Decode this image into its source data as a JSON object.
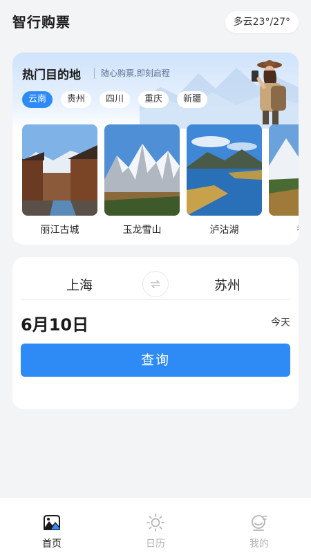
{
  "header": {
    "title": "智行购票",
    "weather": "多云23°/27°"
  },
  "destinations": {
    "title": "热门目的地",
    "subtitle": "随心购票,即刻启程",
    "chips": [
      {
        "label": "云南",
        "active": true
      },
      {
        "label": "贵州",
        "active": false
      },
      {
        "label": "四川",
        "active": false
      },
      {
        "label": "重庆",
        "active": false
      },
      {
        "label": "新疆",
        "active": false
      }
    ],
    "spots": [
      {
        "name": "丽江古城"
      },
      {
        "name": "玉龙雪山"
      },
      {
        "name": "泸沽湖"
      },
      {
        "name": "香格"
      }
    ]
  },
  "route": {
    "from": "上海",
    "to": "苏州",
    "date": "6月10日",
    "date_tag": "今天",
    "search_label": "查询"
  },
  "tabbar": {
    "items": [
      {
        "label": "首页",
        "icon": "home-mountain-icon",
        "active": true
      },
      {
        "label": "日历",
        "icon": "sun-icon",
        "active": false
      },
      {
        "label": "我的",
        "icon": "profile-icon",
        "active": false
      }
    ]
  },
  "colors": {
    "accent": "#2e8bf5",
    "background": "#f3f4f6",
    "card": "#ffffff"
  }
}
